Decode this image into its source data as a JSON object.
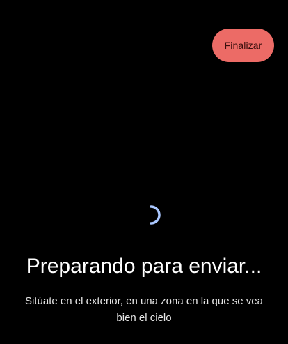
{
  "header": {
    "finish_label": "Finalizar"
  },
  "status": {
    "title": "Preparando para enviar...",
    "subtitle": "Sitúate en el exterior, en una zona en la que se vea bien el cielo"
  },
  "colors": {
    "background": "#000000",
    "finish_button": "#ec6b66",
    "spinner": "#aac7ff"
  },
  "icons": {
    "loading": "loading-spinner-icon"
  }
}
